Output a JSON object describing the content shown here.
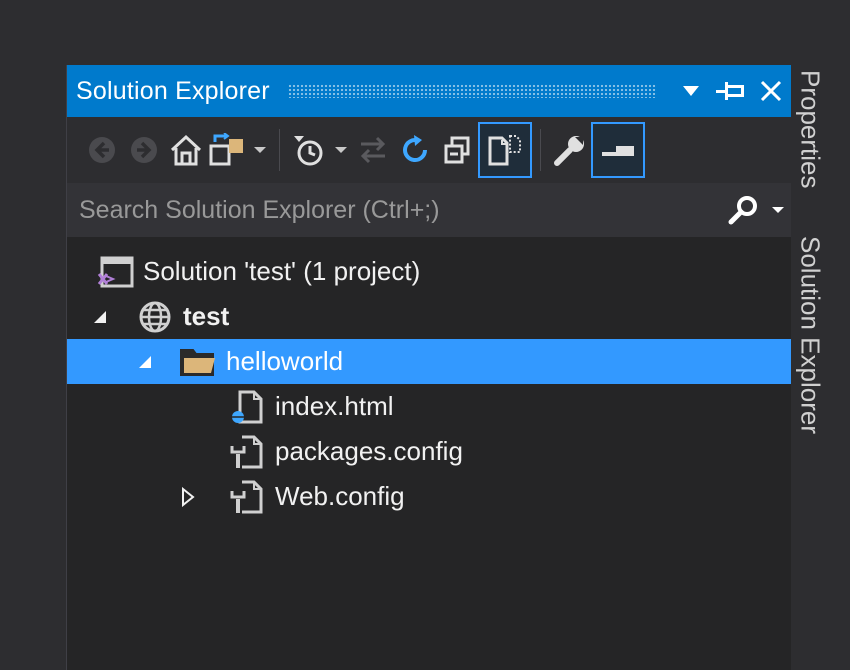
{
  "window": {
    "title": "Solution Explorer"
  },
  "search": {
    "placeholder": "Search Solution Explorer (Ctrl+;)"
  },
  "tree": {
    "solution": "Solution 'test' (1 project)",
    "project": "test",
    "folder": "helloworld",
    "files": [
      "index.html",
      "packages.config",
      "Web.config"
    ]
  },
  "side_tabs": [
    "Properties",
    "Solution Explorer"
  ],
  "colors": {
    "accent": "#007acc",
    "selection": "#3399ff",
    "panel_bg": "#252526",
    "toolbar_bg": "#2d2d30",
    "refresh_blue": "#3ea7ff",
    "folder_gold": "#dcb67a"
  },
  "icons": {
    "toolbar": [
      "back-icon",
      "forward-icon",
      "home-icon",
      "switch-views-icon",
      "dropdown-icon",
      "pending-changes-filter-icon",
      "dropdown-icon",
      "sync-icon",
      "refresh-icon",
      "collapse-all-icon",
      "show-all-files-icon",
      "properties-wrench-icon",
      "preview-selected-icon"
    ],
    "title": [
      "window-position-icon",
      "pin-icon",
      "close-icon"
    ]
  }
}
